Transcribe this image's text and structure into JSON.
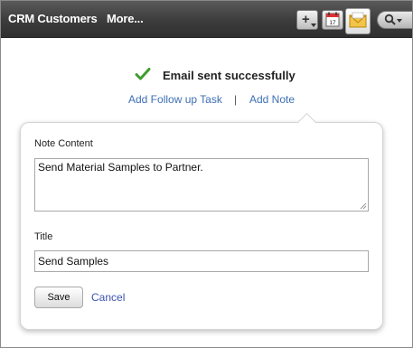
{
  "topbar": {
    "app_title": "CRM Customers",
    "more_label": "More...",
    "colors": {
      "bar": "#3c3c3c",
      "text": "#ffffff"
    },
    "icons": {
      "add": "plus-icon",
      "calendar": "calendar-icon",
      "calendar_day": "17",
      "mail": "envelope-icon",
      "search": "search-icon"
    }
  },
  "status": {
    "icon": "checkmark-icon",
    "message": "Email sent successfully",
    "color": "#3f9c2f"
  },
  "actions": {
    "follow_up": "Add Follow up Task",
    "separator": "|",
    "add_note": "Add Note",
    "link_color": "#3d6fb5"
  },
  "note_form": {
    "content_label": "Note Content",
    "content_value": "Send Material Samples to Partner.",
    "title_label": "Title",
    "title_value": "Send Samples",
    "save_label": "Save",
    "cancel_label": "Cancel"
  }
}
